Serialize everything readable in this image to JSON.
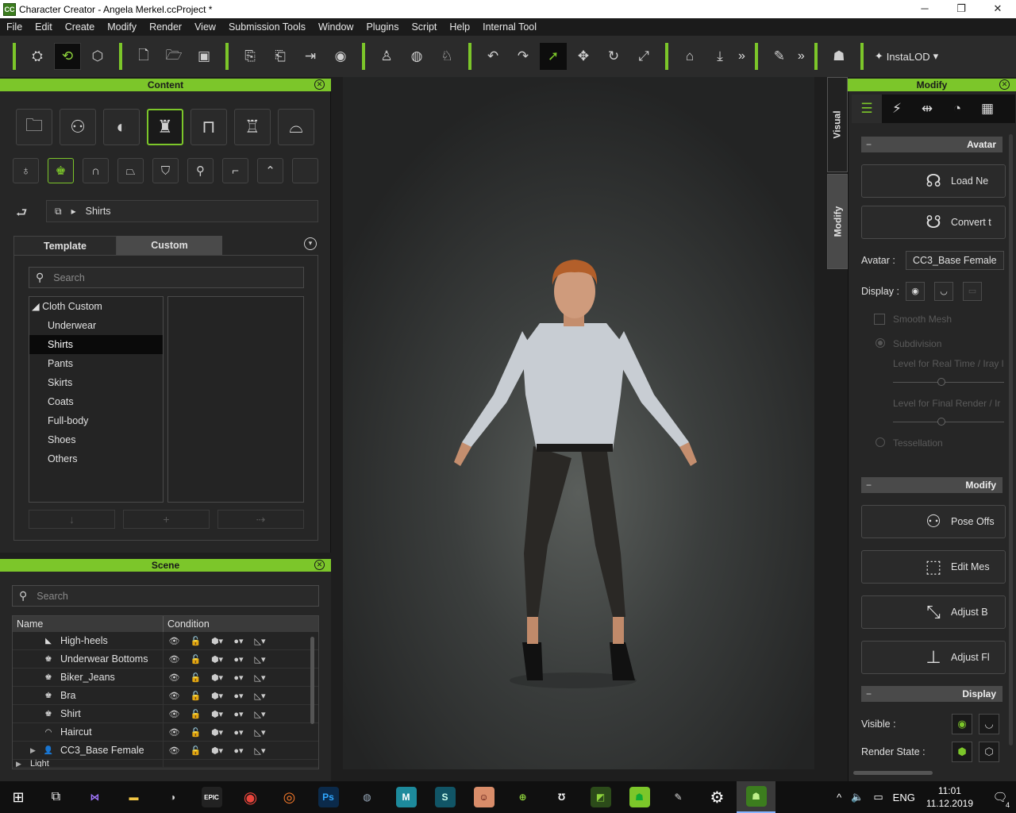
{
  "window": {
    "title": "Character Creator - Angela Merkel.ccProject *",
    "app_icon": "CC",
    "controls": [
      "─",
      "❐",
      "✕"
    ]
  },
  "menu": [
    "File",
    "Edit",
    "Create",
    "Modify",
    "Render",
    "View",
    "Submission Tools",
    "Window",
    "Plugins",
    "Script",
    "Help",
    "Internal Tool"
  ],
  "toolbar": {
    "instalod_label": "InstaLOD",
    "more": "»"
  },
  "content_panel": {
    "title": "Content",
    "breadcrumb": "Shirts",
    "tabs": {
      "template": "Template",
      "custom": "Custom"
    },
    "search_placeholder": "Search",
    "tree": {
      "root": "Cloth Custom",
      "items": [
        "Underwear",
        "Shirts",
        "Pants",
        "Skirts",
        "Coats",
        "Full-body",
        "Shoes",
        "Others"
      ],
      "selected": "Shirts"
    }
  },
  "scene_panel": {
    "title": "Scene",
    "search_placeholder": "Search",
    "columns": {
      "name": "Name",
      "condition": "Condition"
    },
    "rows": [
      {
        "label": "High-heels",
        "icon": "shoe-icon"
      },
      {
        "label": "Underwear Bottoms",
        "icon": "cloth-icon"
      },
      {
        "label": "Biker_Jeans",
        "icon": "cloth-icon"
      },
      {
        "label": "Bra",
        "icon": "cloth-icon"
      },
      {
        "label": "Shirt",
        "icon": "cloth-icon"
      },
      {
        "label": "Haircut",
        "icon": "hair-icon"
      },
      {
        "label": "CC3_Base Female",
        "icon": "avatar-icon"
      },
      {
        "label": "Light",
        "icon": ""
      }
    ]
  },
  "side_tabs": {
    "visual": "Visual",
    "modify": "Modify"
  },
  "modify_panel": {
    "title": "Modify",
    "avatar_section": "Avatar",
    "load_new": "Load Ne",
    "convert_to": "Convert t",
    "avatar_label": "Avatar :",
    "avatar_value": "CC3_Base Female",
    "display_label": "Display :",
    "smooth_mesh": "Smooth Mesh",
    "subdivision": "Subdivision",
    "level_realtime": "Level for Real Time / Iray l",
    "level_final": "Level for Final Render / Ir",
    "tessellation": "Tessellation",
    "modify_section": "Modify",
    "pose_offset": "Pose Offs",
    "edit_mesh": "Edit Mes",
    "adjust_bone": "Adjust B",
    "adjust_floor": "Adjust Fl",
    "display_section": "Display",
    "visible_label": "Visible :",
    "render_state_label": "Render State :"
  },
  "taskbar": {
    "time": "11:01",
    "date": "11.12.2019",
    "lang": "ENG",
    "notifications": "4"
  },
  "colors": {
    "accent": "#7cc62a",
    "panel_bg": "#262626",
    "header_bg": "#4a4a4a"
  }
}
